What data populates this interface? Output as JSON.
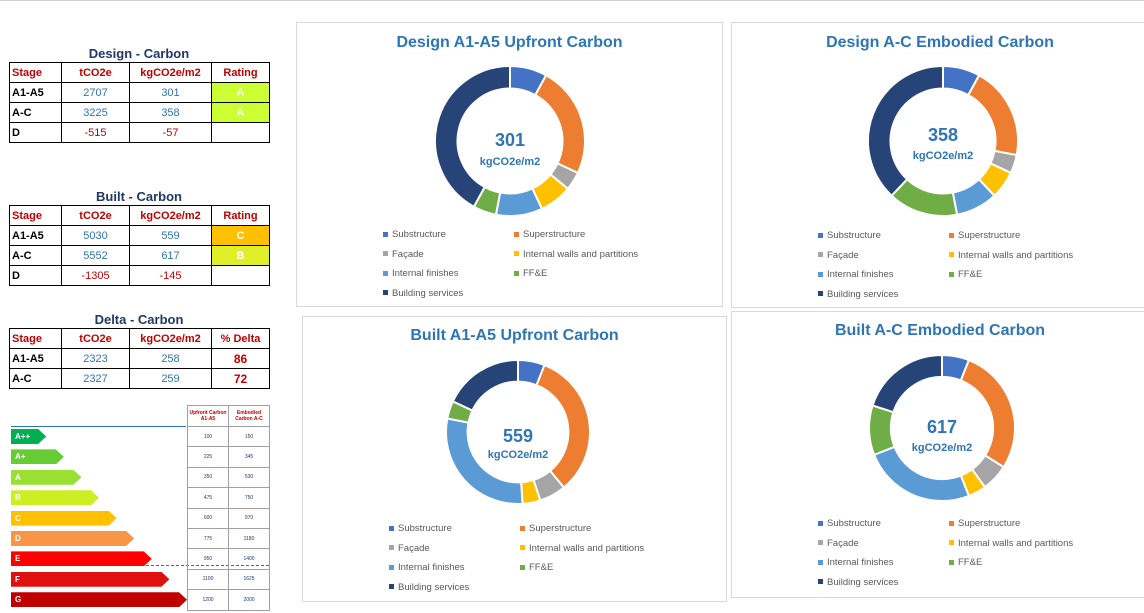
{
  "tables": [
    {
      "title": "Design - Carbon",
      "headers": [
        "Stage",
        "tCO2e",
        "kgCO2e/m2",
        "Rating"
      ],
      "rows": [
        {
          "stage": "A1-A5",
          "t": "2707",
          "kg": "301",
          "extra": "A",
          "extra_color": "#ccff33"
        },
        {
          "stage": "A-C",
          "t": "3225",
          "kg": "358",
          "extra": "A",
          "extra_color": "#ccff33"
        },
        {
          "stage": "D",
          "t": "-515",
          "kg": "-57",
          "extra": "",
          "extra_color": ""
        }
      ]
    },
    {
      "title": "Built - Carbon",
      "headers": [
        "Stage",
        "tCO2e",
        "kgCO2e/m2",
        "Rating"
      ],
      "rows": [
        {
          "stage": "A1-A5",
          "t": "5030",
          "kg": "559",
          "extra": "C",
          "extra_color": "#ffc000"
        },
        {
          "stage": "A-C",
          "t": "5552",
          "kg": "617",
          "extra": "B",
          "extra_color": "#e0f028"
        },
        {
          "stage": "D",
          "t": "-1305",
          "kg": "-145",
          "extra": "",
          "extra_color": ""
        }
      ]
    },
    {
      "title": "Delta - Carbon",
      "headers": [
        "Stage",
        "tCO2e",
        "kgCO2e/m2",
        "% Delta"
      ],
      "rows": [
        {
          "stage": "A1-A5",
          "t": "2323",
          "kg": "258",
          "extra": "86",
          "extra_color": ""
        },
        {
          "stage": "A-C",
          "t": "2327",
          "kg": "259",
          "extra": "72",
          "extra_color": ""
        }
      ]
    }
  ],
  "rating_scale": {
    "header_upfront": "Upfront Carbon A1-A5",
    "header_embodied": "Embodied Carbon A-C",
    "bands": [
      {
        "label": "A++",
        "color": "#00b050",
        "upfront": "100",
        "embodied": "150",
        "length": 0.16
      },
      {
        "label": "A+",
        "color": "#66cc33",
        "upfront": "225",
        "embodied": "345",
        "length": 0.24
      },
      {
        "label": "A",
        "color": "#99e033",
        "upfront": "350",
        "embodied": "530",
        "length": 0.32
      },
      {
        "label": "B",
        "color": "#ccee22",
        "upfront": "475",
        "embodied": "750",
        "length": 0.4
      },
      {
        "label": "C",
        "color": "#ffc000",
        "upfront": "600",
        "embodied": "970",
        "length": 0.48
      },
      {
        "label": "D",
        "color": "#f79646",
        "upfront": "775",
        "embodied": "1180",
        "length": 0.56
      },
      {
        "label": "E",
        "color": "#ff0000",
        "upfront": "950",
        "embodied": "1400",
        "length": 0.64
      },
      {
        "label": "F",
        "color": "#e01010",
        "upfront": "1100",
        "embodied": "1625",
        "length": 0.72
      },
      {
        "label": "G",
        "color": "#c00000",
        "upfront": "1200",
        "embodied": "2000",
        "length": 0.8
      }
    ]
  },
  "legend_labels": [
    "Substructure",
    "Superstructure",
    "Façade",
    "Internal walls and partitions",
    "Internal finishes",
    "FF&E",
    "Building services"
  ],
  "chart_data": [
    {
      "type": "pie",
      "title": "Design A1-A5 Upfront Carbon",
      "center_value": "301",
      "center_unit": "kgCO2e/m2",
      "categories": [
        "Substructure",
        "Superstructure",
        "Façade",
        "Internal walls and partitions",
        "Internal finishes",
        "FF&E",
        "Building services"
      ],
      "values": [
        8,
        24,
        4,
        7,
        10,
        5,
        42
      ],
      "colors": [
        "#4472c4",
        "#ed7d31",
        "#a5a5a5",
        "#ffc000",
        "#5b9bd5",
        "#70ad47",
        "#264478"
      ]
    },
    {
      "type": "pie",
      "title": "Design A-C Embodied Carbon",
      "center_value": "358",
      "center_unit": "kgCO2e/m2",
      "categories": [
        "Substructure",
        "Superstructure",
        "Façade",
        "Internal walls and partitions",
        "Internal finishes",
        "FF&E",
        "Building services"
      ],
      "values": [
        8,
        20,
        4,
        6,
        9,
        15,
        38
      ],
      "colors": [
        "#4472c4",
        "#ed7d31",
        "#a5a5a5",
        "#ffc000",
        "#5b9bd5",
        "#70ad47",
        "#264478"
      ]
    },
    {
      "type": "pie",
      "title": "Built  A1-A5 Upfront Carbon",
      "center_value": "559",
      "center_unit": "kgCO2e/m2",
      "categories": [
        "Substructure",
        "Superstructure",
        "Façade",
        "Internal walls and partitions",
        "Internal finishes",
        "FF&E",
        "Building services"
      ],
      "values": [
        6,
        33,
        6,
        4,
        29,
        4,
        18
      ],
      "colors": [
        "#4472c4",
        "#ed7d31",
        "#a5a5a5",
        "#ffc000",
        "#5b9bd5",
        "#70ad47",
        "#264478"
      ]
    },
    {
      "type": "pie",
      "title": "Built  A-C Embodied Carbon",
      "center_value": "617",
      "center_unit": "kgCO2e/m2",
      "categories": [
        "Substructure",
        "Superstructure",
        "Façade",
        "Internal walls and partitions",
        "Internal finishes",
        "FF&E",
        "Building services"
      ],
      "values": [
        6,
        28,
        6,
        4,
        25,
        11,
        20
      ],
      "colors": [
        "#4472c4",
        "#ed7d31",
        "#a5a5a5",
        "#ffc000",
        "#5b9bd5",
        "#70ad47",
        "#264478"
      ]
    }
  ]
}
